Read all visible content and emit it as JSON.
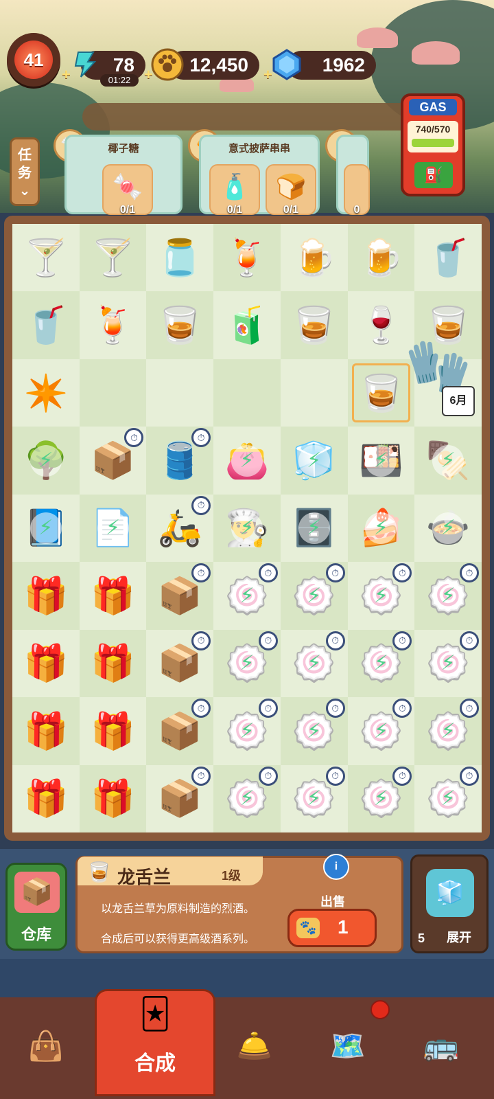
{
  "top": {
    "level": "41",
    "energy": "78",
    "energy_timer": "01:22",
    "coins": "12,450",
    "gems": "1962"
  },
  "gas_pump": {
    "label": "GAS",
    "value": "740/570"
  },
  "task_tab": {
    "label": "任务"
  },
  "orders": [
    {
      "title": "椰子糖",
      "count": "0/1"
    },
    {
      "title": "意式披萨串串",
      "count_a": "0/1",
      "count_b": "0/1"
    },
    {
      "count": "0"
    }
  ],
  "info": {
    "item_name": "龙舌兰",
    "item_level": "1级",
    "desc_line1": "以龙舌兰草为原料制造的烈酒。",
    "desc_line2": "合成后可以获得更高级酒系列。",
    "sell_label": "出售",
    "sell_value": "1",
    "depot_label": "仓库",
    "expand_count": "5",
    "expand_label": "展开"
  },
  "calendar_badge": "6月",
  "nav": {
    "active_label": "合成"
  },
  "colors": {
    "accent_red": "#e4472e",
    "board_bg": "#e7efd8",
    "wood": "#8a5a3a"
  },
  "icons": {
    "nav": [
      "shopping-bag-icon",
      "merge-icon",
      "service-bell-icon",
      "map-icon",
      "bus-icon"
    ]
  }
}
